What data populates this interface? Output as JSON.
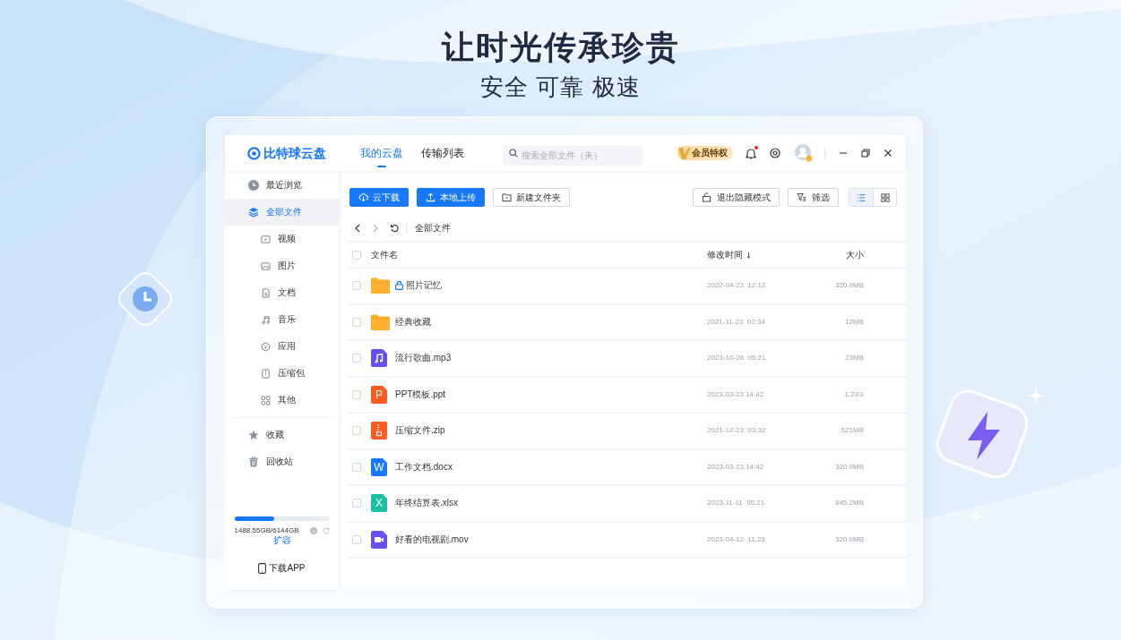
{
  "headline": "让时光传承珍贵",
  "tagline": "安全 可靠 极速",
  "app": {
    "logo_text": "比特球云盘",
    "tabs": [
      {
        "label": "我的云盘",
        "selected": true
      },
      {
        "label": "传输列表",
        "selected": false
      }
    ],
    "search": {
      "placeholder": "搜索全部文件（夹）"
    },
    "vip_badge": "会员特权",
    "notification": true,
    "sidebar": {
      "items": [
        {
          "label": "最近浏览",
          "selected": false
        },
        {
          "label": "全部文件",
          "selected": true,
          "children": [
            {
              "label": "视频",
              "selected": false
            },
            {
              "label": "图片",
              "selected": false
            },
            {
              "label": "文档",
              "selected": false
            },
            {
              "label": "音乐",
              "selected": false
            },
            {
              "label": "应用",
              "selected": false
            },
            {
              "label": "压缩包",
              "selected": false
            },
            {
              "label": "其他",
              "selected": false
            }
          ]
        }
      ],
      "secondary_items": [
        {
          "label": "收藏",
          "selected": false
        },
        {
          "label": "回收站",
          "selected": false
        }
      ],
      "storage": {
        "level": 0.42,
        "usage": "1488.55GB/6144GB",
        "expand_link": "扩容"
      },
      "download_app": "下载APP"
    },
    "toolbar": {
      "buttons": [
        {
          "label": "云下载",
          "kind": "primary"
        },
        {
          "label": "本地上传",
          "kind": "primary"
        },
        {
          "label": "新建文件夹",
          "kind": "outline"
        }
      ],
      "right_buttons": [
        {
          "label": "退出隐藏模式"
        },
        {
          "label": "筛选"
        }
      ],
      "views": [
        {
          "kind": "list",
          "selected": true
        },
        {
          "kind": "grid",
          "selected": false
        }
      ]
    },
    "breadcrumb": [
      "全部文件"
    ],
    "table": {
      "header_checked": false,
      "columns": [
        "文件名",
        "修改时间",
        "大小"
      ],
      "rows": [
        {
          "kind": "folder",
          "name": "照片记忆",
          "locked": true,
          "modified": "2022-04-23  12:12",
          "size": "320.0MB",
          "checked": false
        },
        {
          "kind": "folder",
          "name": "经典收藏",
          "locked": false,
          "modified": "2021-11-23  02:34",
          "size": "12MB",
          "checked": false
        },
        {
          "kind": "music",
          "name": "流行歌曲.mp3",
          "locked": false,
          "modified": "2023-10-28  05:21",
          "size": "23MB",
          "checked": false
        },
        {
          "kind": "ppt",
          "icon_letter": "P",
          "name": "PPT模板.ppt",
          "locked": false,
          "modified": "2023-03-23 14:42",
          "size": "1.23G",
          "checked": false
        },
        {
          "kind": "zip",
          "name": "压缩文件.zip",
          "locked": false,
          "modified": "2021-12-23  03:32",
          "size": "521MB",
          "checked": false
        },
        {
          "kind": "word",
          "icon_letter": "W",
          "name": "工作文档.docx",
          "locked": false,
          "modified": "2023-03-23 14:42",
          "size": "320.0MB",
          "checked": false
        },
        {
          "kind": "excel",
          "icon_letter": "X",
          "name": "年终结算表.xlsx",
          "locked": false,
          "modified": "2023-11-11  05:21",
          "size": "845.2MB",
          "checked": false
        },
        {
          "kind": "video",
          "name": "好看的电视剧.mov",
          "locked": false,
          "modified": "2023-04-12  11:23",
          "size": "320.0MB",
          "checked": false
        }
      ]
    }
  }
}
